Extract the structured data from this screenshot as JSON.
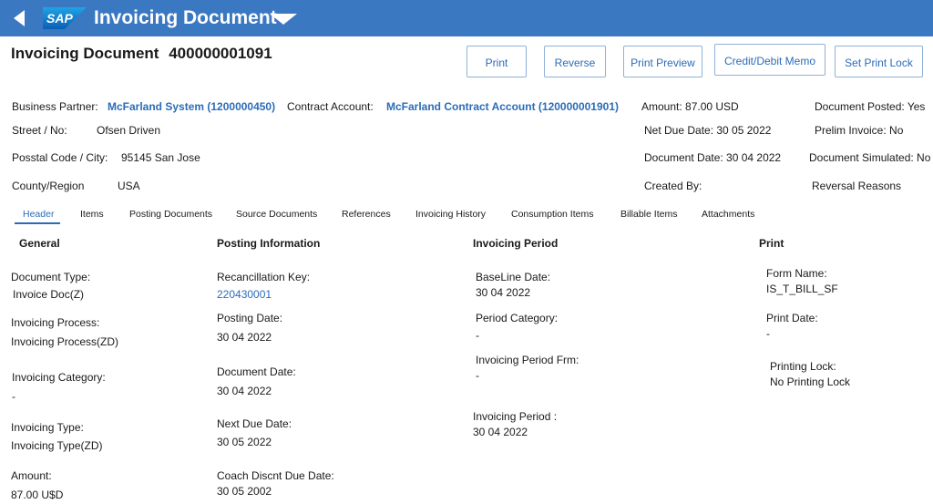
{
  "shell": {
    "logo_text": "SAP",
    "title": "Invoicing Document",
    "back_icon": "back-triangle-icon",
    "caret_icon": "caret-down-icon"
  },
  "document": {
    "title_label": "Invoicing Document",
    "number": "400000001091"
  },
  "actions": {
    "print": "Print",
    "reverse": "Reverse",
    "print_preview": "Print Preview",
    "credit_debit_memo": "Credit/Debit Memo",
    "set_print_lock": "Set Print Lock"
  },
  "header_info": {
    "business_partner_label": "Business Partner:",
    "business_partner_value": "McFarland System (1200000450)",
    "contract_account_label": "Contract Account:",
    "contract_account_value": "McFarland Contract Account (120000001901)",
    "amount": "Amount: 87.00 USD",
    "document_posted": "Document Posted: Yes",
    "street_label": "Street / No:",
    "street_value": "Ofsen Driven",
    "net_due_date": "Net Due Date: 30 05 2022",
    "prelim_invoice": "Prelim Invoice: No",
    "postal_label": "Posstal Code / City:",
    "postal_value": "95145 San Jose",
    "document_date": "Document Date: 30 04 2022",
    "document_simulated": "Document Simulated: No",
    "county_label": "County/Region",
    "county_value": "USA",
    "created_by": "Created By:",
    "reversal_reasons": "Reversal Reasons"
  },
  "tabs": [
    {
      "label": "Header"
    },
    {
      "label": "Items"
    },
    {
      "label": "Posting Documents"
    },
    {
      "label": "Source Documents"
    },
    {
      "label": "References"
    },
    {
      "label": "Invoicing History"
    },
    {
      "label": "Consumption  Items"
    },
    {
      "label": "Billable Items"
    },
    {
      "label": "Attachments"
    }
  ],
  "sections": {
    "general": {
      "title": "General",
      "document_type_label": "Document Type:",
      "document_type_value": "Invoice Doc(Z)",
      "invoicing_process_label": "Invoicing Process:",
      "invoicing_process_value": "Invoicing Process(ZD)",
      "invoicing_category_label": "Invoicing Category:",
      "invoicing_category_value": "-",
      "invoicing_type_label": "Invoicing  Type:",
      "invoicing_type_value": "Invoicing Type(ZD)",
      "amount_label": "Amount:",
      "amount_value": "87.00 U$D"
    },
    "posting": {
      "title": "Posting Information",
      "reconciliation_key_label": "Recancillation Key:",
      "reconciliation_key_value": "220430001",
      "posting_date_label": "Posting Date:",
      "posting_date_value": "30 04 2022",
      "document_date_label": "Document Date:",
      "document_date_value": "30 04 2022",
      "next_due_date_label": "Next Due Date:",
      "next_due_date_value": "30 05 2022",
      "coach_discnt_label": "Coach Discnt Due Date:",
      "coach_discnt_value": "30 05 2002"
    },
    "invoicing_period": {
      "title": "Invoicing Period",
      "baseline_date_label": "BaseLine Date:",
      "baseline_date_value": "30 04 2022",
      "period_category_label": "Period Category:",
      "period_category_value": "-",
      "period_from_label": "Invoicing  Period Frm:",
      "period_from_value": "-",
      "period_to_label": "Invoicing  Period :",
      "period_to_value": "30 04 2022"
    },
    "print": {
      "title": "Print",
      "form_name_label": "Form Name:",
      "form_name_value": "IS_T_BILL_SF",
      "print_date_label": "Print Date:",
      "print_date_value": "-",
      "printing_lock_label": "Printing Lock:",
      "printing_lock_value": "No Printing Lock"
    }
  },
  "colors": {
    "shell_blue": "#3a78c2",
    "link_blue": "#2b6cb8",
    "button_border": "#8fb1d8"
  }
}
